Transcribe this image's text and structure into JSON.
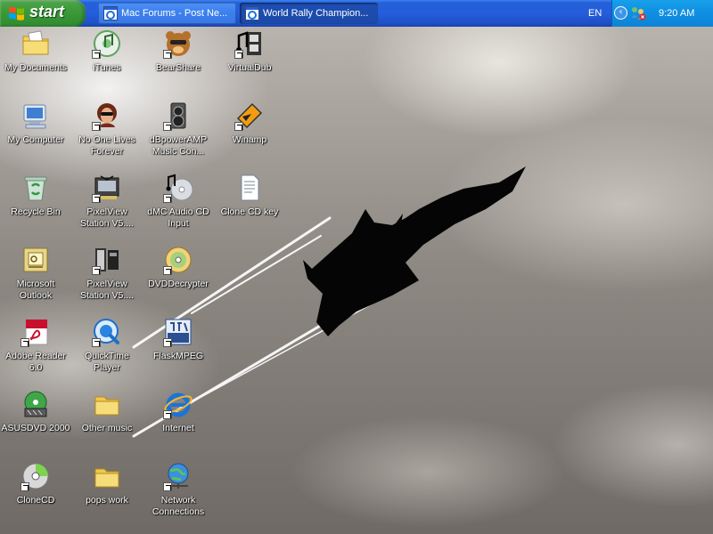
{
  "taskbar": {
    "start_label": "start",
    "tasks": [
      {
        "label": "Mac Forums - Post Ne...",
        "icon": "ie-window-icon",
        "state": "inactive"
      },
      {
        "label": "World Rally Champion...",
        "icon": "ie-window-icon",
        "state": "active"
      }
    ],
    "language": "EN",
    "clock": "9:20 AM"
  },
  "desktop": {
    "icons": [
      {
        "label": "My Documents",
        "icon": "folder-documents-icon"
      },
      {
        "label": "iTunes",
        "icon": "itunes-icon"
      },
      {
        "label": "BearShare",
        "icon": "bearshare-icon"
      },
      {
        "label": "VirtualDub",
        "icon": "virtualdub-icon"
      },
      {
        "label": "My Computer",
        "icon": "computer-icon"
      },
      {
        "label": "No One Lives Forever",
        "icon": "nolf-icon"
      },
      {
        "label": "dBpowerAMP Music Con...",
        "icon": "dbpoweramp-icon"
      },
      {
        "label": "Winamp",
        "icon": "winamp-icon"
      },
      {
        "label": "Recycle Bin",
        "icon": "recycle-bin-icon"
      },
      {
        "label": "PixelView Station V5....",
        "icon": "pixelview-icon"
      },
      {
        "label": "dMC Audio CD Input",
        "icon": "audio-cd-icon"
      },
      {
        "label": "Clone CD key",
        "icon": "text-file-icon"
      },
      {
        "label": "Microsoft Outlook",
        "icon": "outlook-icon"
      },
      {
        "label": "PixelView Station V5....",
        "icon": "pixelview-icon"
      },
      {
        "label": "DVDDecrypter",
        "icon": "dvd-decrypter-icon"
      },
      {
        "label": "Adobe Reader 6.0",
        "icon": "adobe-reader-icon"
      },
      {
        "label": "QuickTime Player",
        "icon": "quicktime-icon"
      },
      {
        "label": "FlaskMPEG",
        "icon": "flaskmpeg-icon"
      },
      {
        "label": "ASUSDVD 2000",
        "icon": "asus-dvd-icon"
      },
      {
        "label": "Other music",
        "icon": "folder-icon"
      },
      {
        "label": "Internet",
        "icon": "internet-explorer-icon"
      },
      {
        "label": "CloneCD",
        "icon": "clonecd-icon"
      },
      {
        "label": "pops work",
        "icon": "folder-icon"
      },
      {
        "label": "Network Connections",
        "icon": "network-connections-icon"
      }
    ]
  }
}
